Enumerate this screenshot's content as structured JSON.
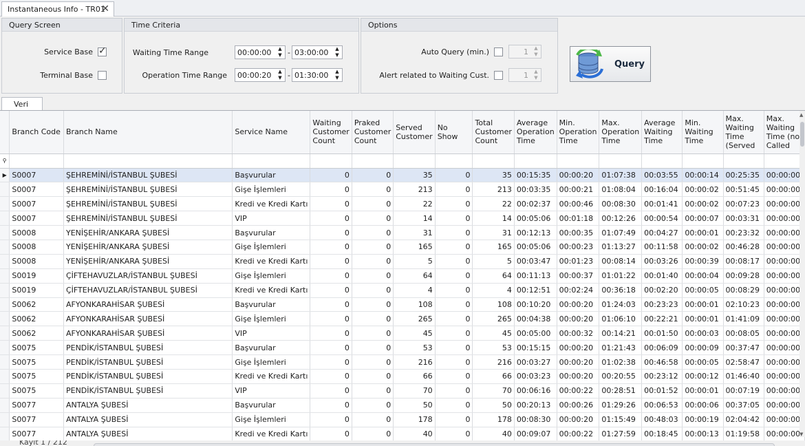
{
  "doc_tab": {
    "title": "Instantaneous Info - TR01",
    "close": "✕"
  },
  "query_screen": {
    "header": "Query Screen",
    "service_base_label": "Service Base",
    "service_base_checked": true,
    "terminal_base_label": "Terminal Base",
    "terminal_base_checked": false
  },
  "time_criteria": {
    "header": "Time Criteria",
    "waiting_label": "Waiting Time Range",
    "waiting_from": "00:00:00",
    "waiting_to": "03:00:00",
    "operation_label": "Operation Time Range",
    "operation_from": "00:00:20",
    "operation_to": "01:30:00",
    "separator": "-"
  },
  "options": {
    "header": "Options",
    "auto_query_label": "Auto Query (min.)",
    "auto_query_value": "1",
    "alert_label": "Alert related to Waiting Cust.",
    "alert_value": "1"
  },
  "query_button": {
    "label": "Query"
  },
  "bottom_tab": {
    "label": "Veri"
  },
  "grid": {
    "columns": [
      "Branch Code",
      "Branch Name",
      "Service Name",
      "Waiting Customer Count",
      "Praked Customer Count",
      "Served Customer",
      "No Show",
      "Total Customer Count",
      "Average Operation Time",
      "Min. Operation Time",
      "Max. Operation Time",
      "Average Waiting Time",
      "Min. Waiting Time",
      "Max. Waiting Time (Served",
      "Max. Waiting Time (no Called"
    ],
    "rows": [
      [
        "S0007",
        "ŞEHREMİNİ/İSTANBUL ŞUBESİ",
        "Başvurular",
        "0",
        "0",
        "35",
        "0",
        "35",
        "00:15:35",
        "00:00:20",
        "01:07:38",
        "00:03:55",
        "00:00:14",
        "00:25:35",
        "00:00:00"
      ],
      [
        "S0007",
        "ŞEHREMİNİ/İSTANBUL ŞUBESİ",
        "Gişe İşlemleri",
        "0",
        "0",
        "213",
        "0",
        "213",
        "00:03:35",
        "00:00:21",
        "01:08:04",
        "00:16:04",
        "00:00:02",
        "00:51:45",
        "00:00:00"
      ],
      [
        "S0007",
        "ŞEHREMİNİ/İSTANBUL ŞUBESİ",
        "Kredi ve Kredi Kartı",
        "0",
        "0",
        "22",
        "0",
        "22",
        "00:02:37",
        "00:00:46",
        "00:08:30",
        "00:01:41",
        "00:00:02",
        "00:07:23",
        "00:00:00"
      ],
      [
        "S0007",
        "ŞEHREMİNİ/İSTANBUL ŞUBESİ",
        "VIP",
        "0",
        "0",
        "14",
        "0",
        "14",
        "00:05:06",
        "00:01:18",
        "00:12:26",
        "00:00:54",
        "00:00:07",
        "00:03:31",
        "00:00:00"
      ],
      [
        "S0008",
        "YENİŞEHİR/ANKARA ŞUBESİ",
        "Başvurular",
        "0",
        "0",
        "31",
        "0",
        "31",
        "00:12:13",
        "00:00:35",
        "01:07:49",
        "00:04:27",
        "00:00:01",
        "00:23:32",
        "00:00:00"
      ],
      [
        "S0008",
        "YENİŞEHİR/ANKARA ŞUBESİ",
        "Gişe İşlemleri",
        "0",
        "0",
        "165",
        "0",
        "165",
        "00:05:06",
        "00:00:23",
        "01:13:27",
        "00:11:58",
        "00:00:02",
        "00:46:28",
        "00:00:00"
      ],
      [
        "S0008",
        "YENİŞEHİR/ANKARA ŞUBESİ",
        "Kredi ve Kredi Kartı",
        "0",
        "0",
        "5",
        "0",
        "5",
        "00:03:47",
        "00:01:23",
        "00:08:14",
        "00:03:26",
        "00:00:39",
        "00:08:17",
        "00:00:00"
      ],
      [
        "S0019",
        "ÇİFTEHAVUZLAR/İSTANBUL ŞUBESİ",
        "Gişe İşlemleri",
        "0",
        "0",
        "64",
        "0",
        "64",
        "00:11:13",
        "00:00:37",
        "01:01:22",
        "00:01:40",
        "00:00:04",
        "00:09:28",
        "00:00:00"
      ],
      [
        "S0019",
        "ÇİFTEHAVUZLAR/İSTANBUL ŞUBESİ",
        "Kredi ve Kredi Kartı",
        "0",
        "0",
        "4",
        "0",
        "4",
        "00:12:51",
        "00:02:24",
        "00:36:18",
        "00:02:20",
        "00:00:05",
        "00:08:29",
        "00:00:00"
      ],
      [
        "S0062",
        "AFYONKARAHİSAR ŞUBESİ",
        "Başvurular",
        "0",
        "0",
        "108",
        "0",
        "108",
        "00:10:20",
        "00:00:20",
        "01:24:03",
        "00:23:23",
        "00:00:01",
        "02:10:23",
        "00:00:00"
      ],
      [
        "S0062",
        "AFYONKARAHİSAR ŞUBESİ",
        "Gişe İşlemleri",
        "0",
        "0",
        "265",
        "0",
        "265",
        "00:04:38",
        "00:00:20",
        "01:06:10",
        "00:22:21",
        "00:00:01",
        "01:41:09",
        "00:00:00"
      ],
      [
        "S0062",
        "AFYONKARAHİSAR ŞUBESİ",
        "VIP",
        "0",
        "0",
        "45",
        "0",
        "45",
        "00:05:00",
        "00:00:32",
        "00:14:21",
        "00:01:50",
        "00:00:03",
        "00:08:05",
        "00:00:00"
      ],
      [
        "S0075",
        "PENDİK/İSTANBUL ŞUBESİ",
        "Başvurular",
        "0",
        "0",
        "53",
        "0",
        "53",
        "00:15:15",
        "00:00:20",
        "01:21:43",
        "00:06:09",
        "00:00:09",
        "00:37:47",
        "00:00:00"
      ],
      [
        "S0075",
        "PENDİK/İSTANBUL ŞUBESİ",
        "Gişe İşlemleri",
        "0",
        "0",
        "216",
        "0",
        "216",
        "00:03:27",
        "00:00:20",
        "01:02:38",
        "00:46:58",
        "00:00:05",
        "02:58:47",
        "00:00:00"
      ],
      [
        "S0075",
        "PENDİK/İSTANBUL ŞUBESİ",
        "Kredi ve Kredi Kartı",
        "0",
        "0",
        "66",
        "0",
        "66",
        "00:03:23",
        "00:00:20",
        "00:20:55",
        "00:23:12",
        "00:00:12",
        "01:46:40",
        "00:00:00"
      ],
      [
        "S0075",
        "PENDİK/İSTANBUL ŞUBESİ",
        "VIP",
        "0",
        "0",
        "70",
        "0",
        "70",
        "00:06:16",
        "00:00:22",
        "00:28:51",
        "00:01:52",
        "00:00:01",
        "00:07:19",
        "00:00:00"
      ],
      [
        "S0077",
        "ANTALYA ŞUBESİ",
        "Başvurular",
        "0",
        "0",
        "50",
        "0",
        "50",
        "00:20:13",
        "00:00:26",
        "01:29:26",
        "00:06:53",
        "00:00:06",
        "00:37:05",
        "00:00:00"
      ],
      [
        "S0077",
        "ANTALYA ŞUBESİ",
        "Gişe İşlemleri",
        "0",
        "0",
        "178",
        "0",
        "178",
        "00:08:30",
        "00:00:20",
        "01:15:49",
        "00:48:03",
        "00:00:19",
        "02:04:42",
        "00:00:00"
      ],
      [
        "S0077",
        "ANTALYA ŞUBESİ",
        "Kredi ve Kredi Kartı",
        "0",
        "0",
        "40",
        "0",
        "40",
        "00:09:07",
        "00:00:22",
        "01:27:59",
        "00:18:45",
        "00:00:13",
        "01:19:58",
        "00:00:00"
      ]
    ]
  },
  "footer": {
    "record_text": "Kayıt 1 / 212"
  }
}
